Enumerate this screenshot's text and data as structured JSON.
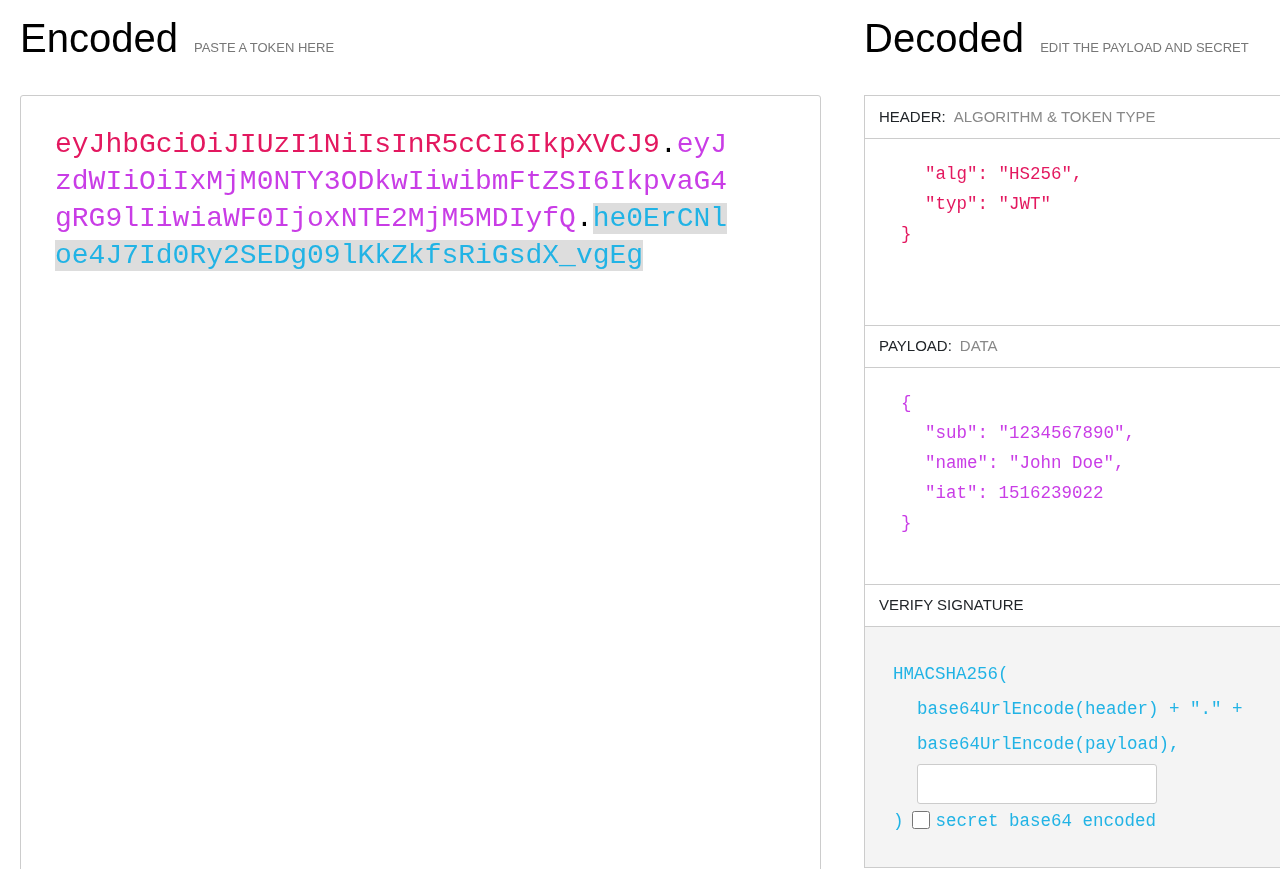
{
  "encoded": {
    "title": "Encoded",
    "subtitle": "PASTE A TOKEN HERE",
    "segments": [
      {
        "kind": "part",
        "text": "eyJhbGciOiJIUzI1NiIsInR5cCI6IkpXVCJ9",
        "color": "#e3185f",
        "selected": false
      },
      {
        "kind": "dot",
        "text": ".",
        "selected": false
      },
      {
        "kind": "part",
        "text": "eyJzdWIiOiIxMjM0NTY3ODkwIiwibmFtZSI6IkpvaG4gRG9lIiwiaWF0IjoxNTE2MjM5MDIyfQ",
        "color": "#c93de6",
        "selected": false
      },
      {
        "kind": "dot",
        "text": ".",
        "selected": false
      },
      {
        "kind": "part",
        "text": "he0ErCNloe4J7Id0Ry2SEDg09lKkZkfsRiGsdX_vgEg",
        "color": "#21b3e5",
        "selected": true
      }
    ]
  },
  "decoded": {
    "title": "Decoded",
    "subtitle": "EDIT THE PAYLOAD AND SECRET",
    "sections": [
      {
        "kind": "json",
        "label": "HEADER:",
        "sublabel": "ALGORITHM & TOKEN TYPE",
        "color": "#e3185f",
        "entries": [
          "\"alg\": \"HS256\",",
          "\"typ\": \"JWT\""
        ],
        "close": "}"
      },
      {
        "kind": "json",
        "label": "PAYLOAD:",
        "sublabel": "DATA",
        "color": "#c93de6",
        "open": "{",
        "entries": [
          "\"sub\": \"1234567890\",",
          "\"name\": \"John Doe\",",
          "\"iat\": 1516239022"
        ],
        "close": "}"
      },
      {
        "kind": "verify",
        "label": "VERIFY SIGNATURE",
        "color": "#21b3e5",
        "call": "HMACSHA256(",
        "args": [
          "base64UrlEncode(header) + \".\" +",
          "base64UrlEncode(payload),"
        ],
        "close": ")",
        "checkbox": {
          "label": "secret base64 encoded",
          "checked": false
        }
      }
    ]
  }
}
